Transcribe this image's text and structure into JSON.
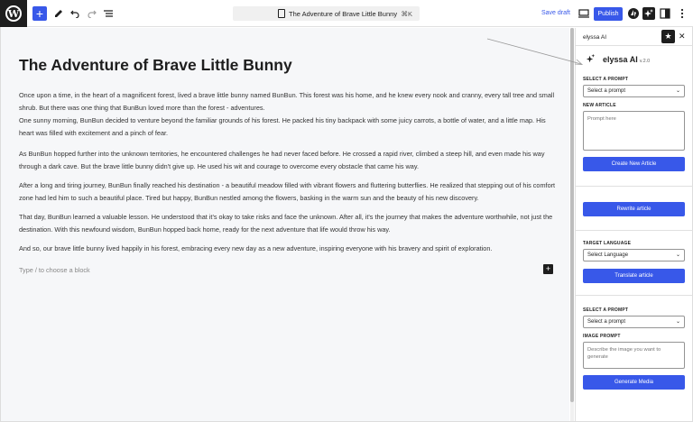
{
  "toolbar": {
    "logo": "W",
    "doc_title": "The Adventure of Brave Little Bunny",
    "shortcut": "⌘K",
    "save_draft": "Save draft",
    "publish": "Publish"
  },
  "post": {
    "title": "The Adventure of Brave Little Bunny",
    "paragraphs": [
      "Once upon a time, in the heart of a magnificent forest, lived a brave little bunny named BunBun. This forest was his home, and he knew every nook and cranny, every tall tree and small shrub. But there was one thing that BunBun loved more than the forest - adventures.",
      "One sunny morning, BunBun decided to venture beyond the familiar grounds of his forest. He packed his tiny backpack with some juicy carrots, a bottle of water, and a little map. His heart was filled with excitement and a pinch of fear.",
      "As BunBun hopped further into the unknown territories, he encountered challenges he had never faced before. He crossed a rapid river, climbed a steep hill, and even made his way through a dark cave. But the brave little bunny didn't give up. He used his wit and courage to overcome every obstacle that came his way.",
      "After a long and tiring journey, BunBun finally reached his destination - a beautiful meadow filled with vibrant flowers and fluttering butterflies. He realized that stepping out of his comfort zone had led him to such a beautiful place. Tired but happy, BunBun nestled among the flowers, basking in the warm sun and the beauty of his new discovery.",
      "That day, BunBun learned a valuable lesson. He understood that it's okay to take risks and face the unknown. After all, it's the journey that makes the adventure worthwhile, not just the destination. With this newfound wisdom, BunBun hopped back home, ready for the next adventure that life would throw his way.",
      "And so, our brave little bunny lived happily in his forest, embracing every new day as a new adventure, inspiring everyone with his bravery and spirit of exploration."
    ],
    "block_placeholder": "Type / to choose a block"
  },
  "sidebar": {
    "panel_title": "elyssa AI",
    "plugin_name": "elyssa AI",
    "plugin_version": "v.2.0",
    "select_prompt_label": "SELECT A PROMPT",
    "select_prompt_value": "Select a prompt",
    "new_article_label": "NEW ARTICLE",
    "new_article_placeholder": "Prompt here",
    "create_button": "Create New Article",
    "rewrite_button": "Rewrite article",
    "target_language_label": "TARGET LANGUAGE",
    "target_language_value": "Select Language",
    "translate_button": "Translate article",
    "image_select_label": "SELECT A PROMPT",
    "image_select_value": "Select a prompt",
    "image_prompt_label": "IMAGE PROMPT",
    "image_prompt_placeholder": "Describe the image you want to generate",
    "generate_button": "Generate Media"
  },
  "colors": {
    "accent": "#3858e9",
    "dark": "#1e1e1e",
    "canvas": "#f6f7f9"
  }
}
